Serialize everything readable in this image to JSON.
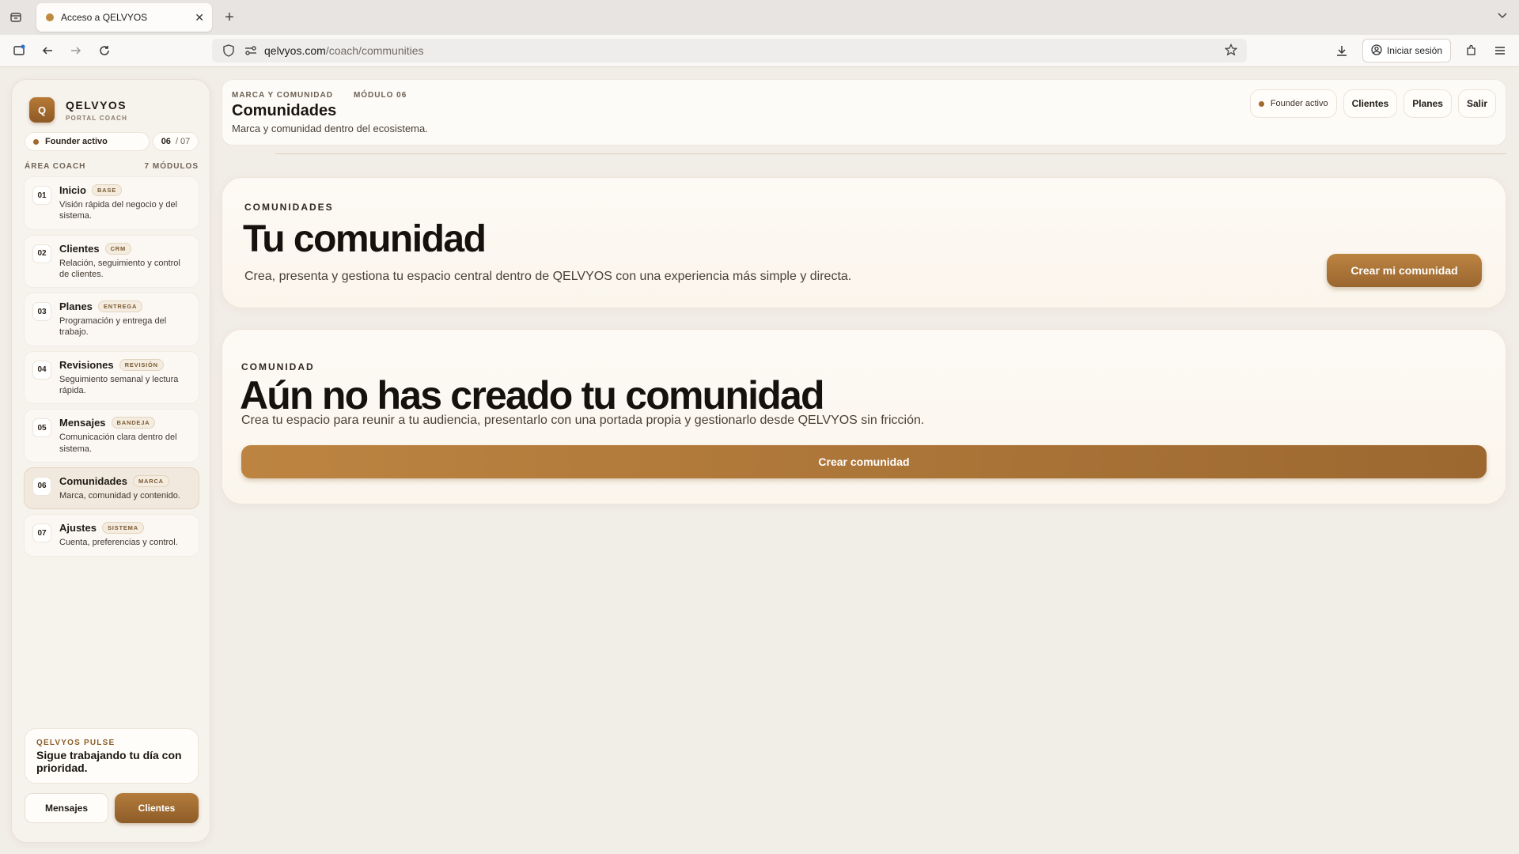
{
  "browser": {
    "tab_title": "Acceso a QELVYOS",
    "url_host": "qelvyos.com",
    "url_path": "/coach/communities",
    "signin_label": "Iniciar sesión"
  },
  "sidebar": {
    "brand_logo": "Q",
    "brand_name": "QELVYOS",
    "brand_sub": "PORTAL COACH",
    "founder_status": "Founder activo",
    "module_current": "06",
    "module_total": "/ 07",
    "area_label": "ÁREA COACH",
    "area_count": "7 MÓDULOS",
    "items": [
      {
        "num": "01",
        "title": "Inicio",
        "badge": "BASE",
        "desc": "Visión rápida del negocio y del sistema."
      },
      {
        "num": "02",
        "title": "Clientes",
        "badge": "CRM",
        "desc": "Relación, seguimiento y control de clientes."
      },
      {
        "num": "03",
        "title": "Planes",
        "badge": "ENTREGA",
        "desc": "Programación y entrega del trabajo."
      },
      {
        "num": "04",
        "title": "Revisiones",
        "badge": "REVISIÓN",
        "desc": "Seguimiento semanal y lectura rápida."
      },
      {
        "num": "05",
        "title": "Mensajes",
        "badge": "BANDEJA",
        "desc": "Comunicación clara dentro del sistema."
      },
      {
        "num": "06",
        "title": "Comunidades",
        "badge": "MARCA",
        "desc": "Marca, comunidad y contenido."
      },
      {
        "num": "07",
        "title": "Ajustes",
        "badge": "SISTEMA",
        "desc": "Cuenta, preferencias y control."
      }
    ],
    "pulse_label": "QELVYOS PULSE",
    "pulse_text": "Sigue trabajando tu día con prioridad.",
    "btn_messages": "Mensajes",
    "btn_clients": "Clientes"
  },
  "header": {
    "crumb_1": "MARCA Y COMUNIDAD",
    "crumb_2": "MÓDULO 06",
    "title": "Comunidades",
    "subtitle": "Marca y comunidad dentro del ecosistema.",
    "founder_status": "Founder activo",
    "btn_clients": "Clientes",
    "btn_plans": "Planes",
    "btn_exit": "Salir"
  },
  "card1": {
    "eyebrow": "COMUNIDADES",
    "title": "Tu comunidad",
    "desc": "Crea, presenta y gestiona tu espacio central dentro de QELVYOS con una experiencia más simple y directa.",
    "button": "Crear mi comunidad"
  },
  "card2": {
    "eyebrow": "COMUNIDAD",
    "title": "Aún no has creado tu comunidad",
    "desc": "Crea tu espacio para reunir a tu audiencia, presentarlo con una portada propia y gestionarlo desde QELVYOS sin fricción.",
    "button": "Crear comunidad"
  },
  "colors": {
    "accent": "#a06a2e",
    "background": "#f1ede7",
    "active_item": "#f1e9de"
  },
  "active_module": 6
}
